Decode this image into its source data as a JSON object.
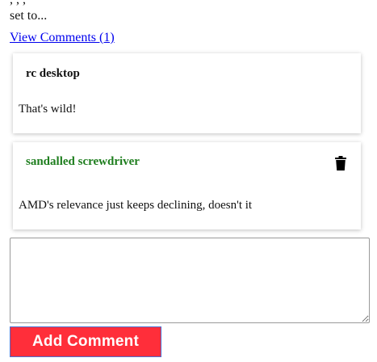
{
  "post": {
    "line1": "                                                   ,  ,                          ,",
    "line2": "set to..."
  },
  "comments_toggle": {
    "label": "View Comments (1)"
  },
  "comments": [
    {
      "author": "rc desktop",
      "author_color": "#111111",
      "text": "That's wild!"
    },
    {
      "author": "sandalled screwdriver",
      "author_color": "#1e7e1e",
      "text": "AMD's relevance just keeps declining, doesn't it",
      "delete_icon": "trash-icon"
    }
  ],
  "comment_form": {
    "textarea_value": "",
    "submit_label": "Add Comment",
    "submit_color": "#ff2e3a"
  }
}
